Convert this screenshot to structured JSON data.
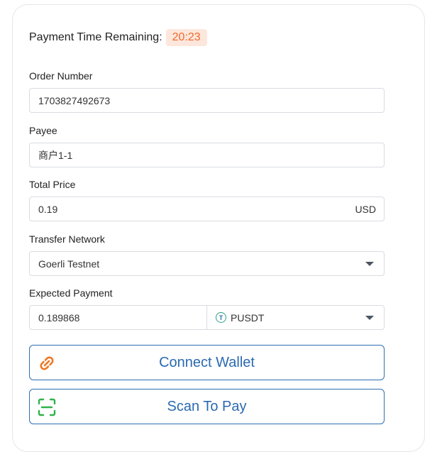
{
  "timer": {
    "label": "Payment Time Remaining:",
    "value": "20:23"
  },
  "order": {
    "label": "Order Number",
    "value": "1703827492673"
  },
  "payee": {
    "label": "Payee",
    "value": "商户1-1"
  },
  "total": {
    "label": "Total Price",
    "value": "0.19",
    "currency": "USD"
  },
  "network": {
    "label": "Transfer Network",
    "selected": "Goerli Testnet"
  },
  "expected": {
    "label": "Expected Payment",
    "amount": "0.189868",
    "token_symbol_letter": "T",
    "token": "PUSDT"
  },
  "buttons": {
    "connect_wallet": "Connect Wallet",
    "scan_to_pay": "Scan To Pay"
  },
  "icons": {
    "connect": "link-icon",
    "scan": "scan-icon",
    "token": "tether-icon"
  },
  "colors": {
    "accent": "#2a6ab0",
    "timer": "#ef6a2e",
    "timer_bg": "#fde7dc",
    "link_icon": "#f07722",
    "scan_icon": "#2fb24c"
  }
}
